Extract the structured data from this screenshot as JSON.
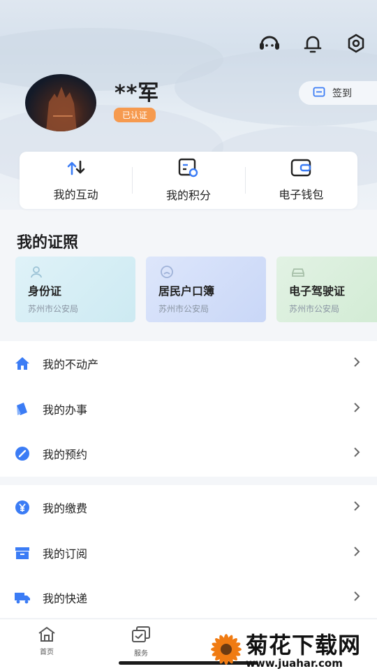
{
  "header": {
    "icons": [
      "customer-service-icon",
      "bell-icon",
      "gear-icon"
    ]
  },
  "profile": {
    "username": "**军",
    "verified_badge": "已认证",
    "signin_label": "签到"
  },
  "quick_actions": [
    {
      "label": "我的互动",
      "icon": "interaction-icon"
    },
    {
      "label": "我的积分",
      "icon": "points-icon"
    },
    {
      "label": "电子钱包",
      "icon": "wallet-icon"
    }
  ],
  "certificates": {
    "title": "我的证照",
    "items": [
      {
        "name": "身份证",
        "issuer": "苏州市公安局",
        "icon": "person-icon"
      },
      {
        "name": "居民户口簿",
        "issuer": "苏州市公安局",
        "icon": "household-icon"
      },
      {
        "name": "电子驾驶证",
        "issuer": "苏州市公安局",
        "icon": "car-icon"
      }
    ]
  },
  "menu_group_1": [
    {
      "label": "我的不动产",
      "icon": "house-icon"
    },
    {
      "label": "我的办事",
      "icon": "affairs-icon"
    },
    {
      "label": "我的预约",
      "icon": "appointment-icon"
    }
  ],
  "menu_group_2": [
    {
      "label": "我的缴费",
      "icon": "payment-icon"
    },
    {
      "label": "我的订阅",
      "icon": "subscription-icon"
    },
    {
      "label": "我的快递",
      "icon": "truck-icon"
    }
  ],
  "tabbar": {
    "tabs": [
      {
        "label": "首页",
        "icon": "home-icon"
      },
      {
        "label": "服务",
        "icon": "service-icon"
      }
    ]
  },
  "watermark": {
    "title": "菊花下载网",
    "url": "www.juahar.com"
  },
  "colors": {
    "accent": "#3b7cf5",
    "badge": "#f69a4f"
  }
}
